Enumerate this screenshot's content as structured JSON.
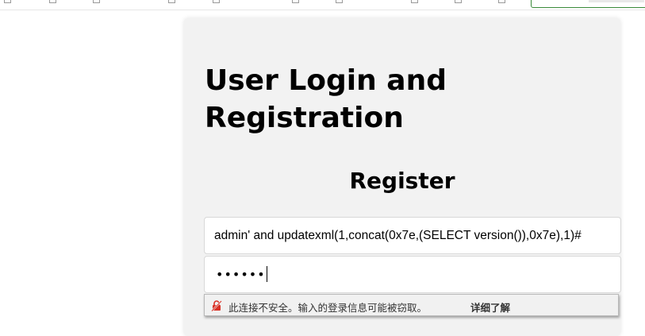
{
  "page": {
    "title": "User Login and Registration",
    "section_title": "Register"
  },
  "form": {
    "username_value": "admin' and updatexml(1,concat(0x7e,(SELECT version()),0x7e),1)#",
    "password_masked": "••••••"
  },
  "autofill_warning": {
    "icon": "insecure-lock-icon",
    "message": "此连接不安全。输入的登录信息可能被窃取。",
    "link_label": "详细了解",
    "icon_color": "#d93025"
  },
  "colors": {
    "card_background": "#f2f2f2",
    "search_border": "#3a8a3a"
  }
}
